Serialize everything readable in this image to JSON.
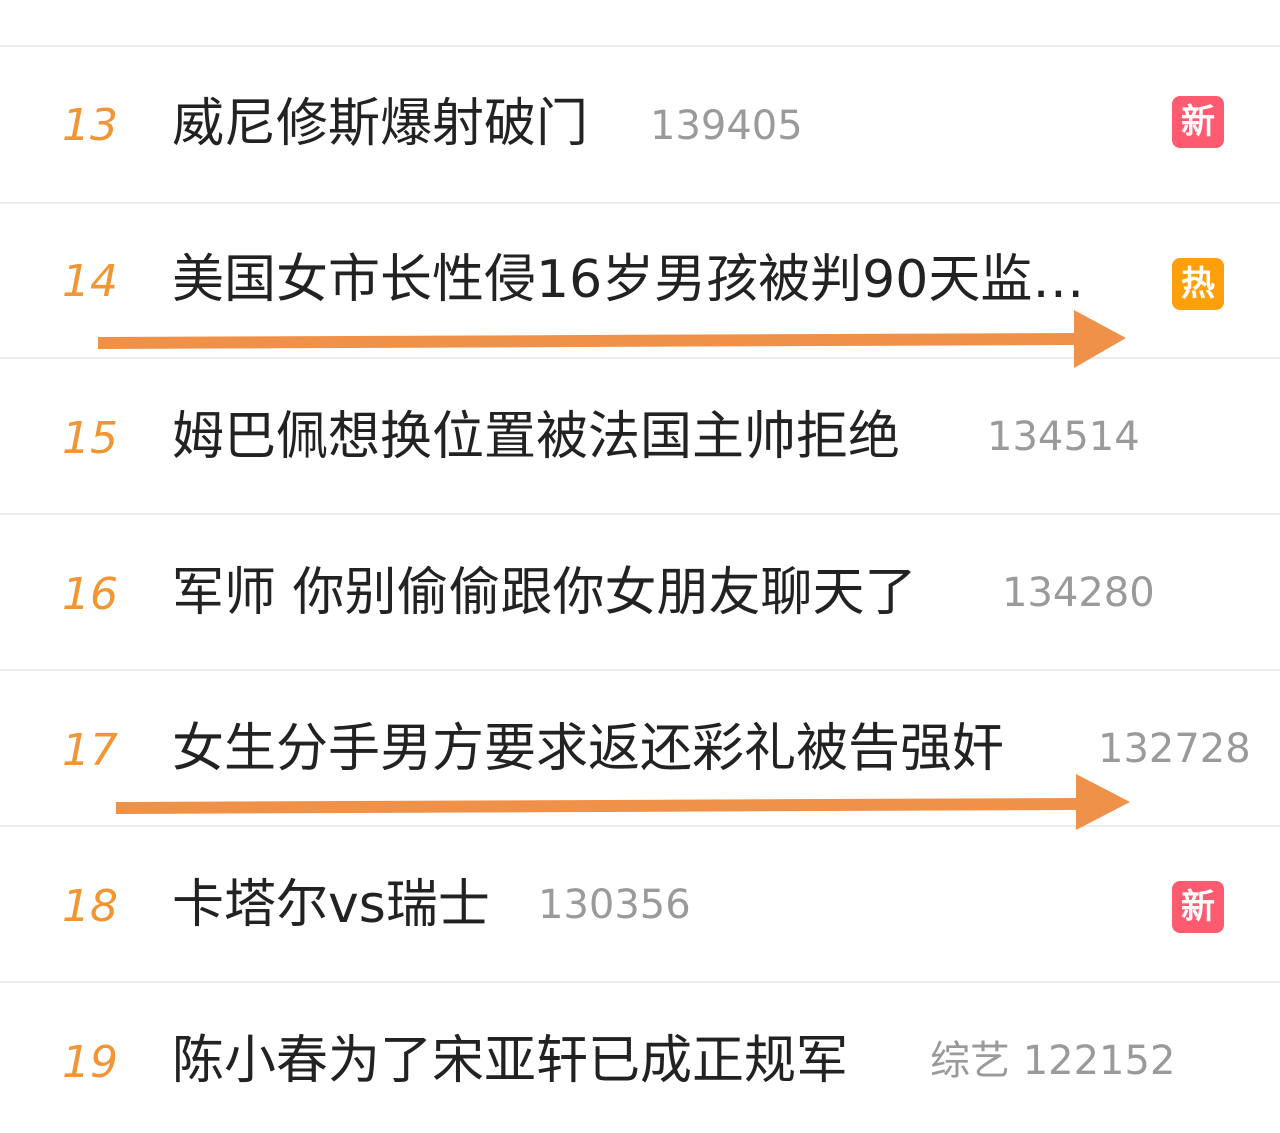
{
  "list": {
    "rows": [
      {
        "rank": "13",
        "title": "威尼修斯爆射破门",
        "count": "139405",
        "badge": "新",
        "badge_type": "new"
      },
      {
        "rank": "14",
        "title": "美国女市长性侵16岁男孩被判90天监…",
        "count": "",
        "badge": "热",
        "badge_type": "hot"
      },
      {
        "rank": "15",
        "title": "姆巴佩想换位置被法国主帅拒绝",
        "count": "134514",
        "badge": "",
        "badge_type": ""
      },
      {
        "rank": "16",
        "title": "军师 你别偷偷跟你女朋友聊天了",
        "count": "134280",
        "badge": "",
        "badge_type": ""
      },
      {
        "rank": "17",
        "title": "女生分手男方要求返还彩礼被告强奸",
        "count": "132728",
        "badge": "",
        "badge_type": ""
      },
      {
        "rank": "18",
        "title": "卡塔尔vs瑞士",
        "count": "130356",
        "badge": "新",
        "badge_type": "new"
      },
      {
        "rank": "19",
        "title": "陈小春为了宋亚轩已成正规军",
        "count": "综艺 122152",
        "badge": "",
        "badge_type": ""
      }
    ]
  },
  "colors": {
    "rank": "#f29634",
    "annotation_arrow": "#f0914a",
    "badge_new": "#ff5b70",
    "badge_hot": "#ff9f0a"
  }
}
